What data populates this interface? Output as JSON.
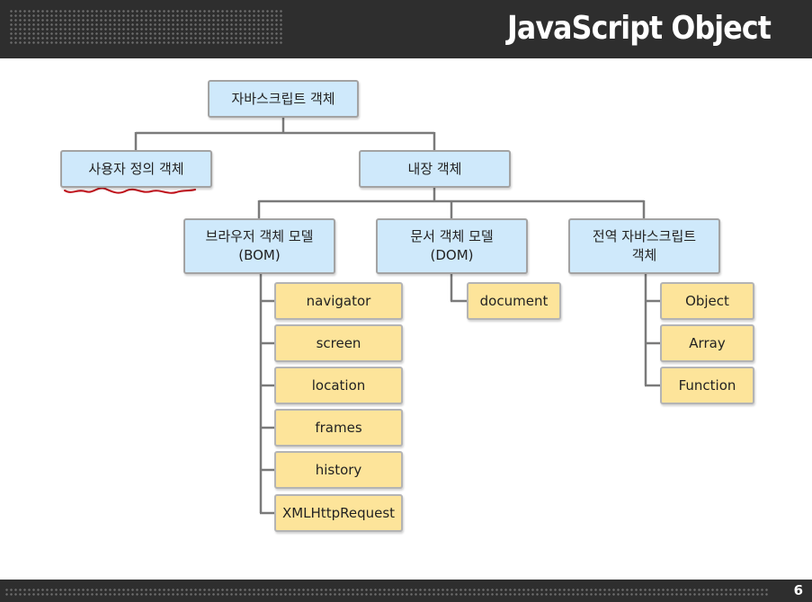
{
  "header": {
    "title": "JavaScript Object"
  },
  "footer": {
    "page_number": "6"
  },
  "diagram": {
    "root": "자바스크립트 객체",
    "user_defined": "사용자 정의 객체",
    "builtin": "내장 객체",
    "bom": {
      "line1": "브라우저 객체 모델",
      "line2": "(BOM)"
    },
    "dom": {
      "line1": "문서 객체 모델",
      "line2": "(DOM)"
    },
    "global": {
      "line1": "전역 자바스크립트",
      "line2": "객체"
    },
    "bom_items": [
      "navigator",
      "screen",
      "location",
      "frames",
      "history",
      "XMLHttpRequest"
    ],
    "dom_items": [
      "document"
    ],
    "global_items": [
      "Object",
      "Array",
      "Function"
    ]
  },
  "colors": {
    "category_fill": "#cfe9fb",
    "leaf_fill": "#fde49a",
    "connector": "#7a7a7a",
    "annotation": "#c0101a"
  }
}
